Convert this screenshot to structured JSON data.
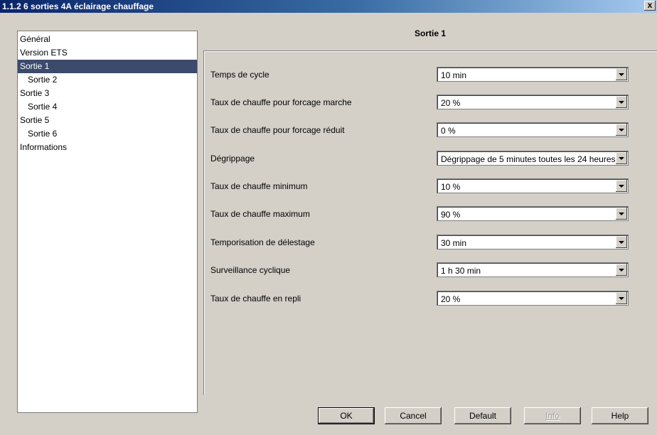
{
  "window": {
    "title": "1.1.2 6 sorties 4A éclairage chauffage",
    "close_glyph": "x"
  },
  "tree": {
    "items": [
      {
        "label": "Général",
        "level": 0,
        "selected": false
      },
      {
        "label": "Version ETS",
        "level": 0,
        "selected": false
      },
      {
        "label": "Sortie 1",
        "level": 0,
        "selected": true
      },
      {
        "label": "Sortie 2",
        "level": 1,
        "selected": false
      },
      {
        "label": "Sortie 3",
        "level": 0,
        "selected": false
      },
      {
        "label": "Sortie 4",
        "level": 1,
        "selected": false
      },
      {
        "label": "Sortie 5",
        "level": 0,
        "selected": false
      },
      {
        "label": "Sortie 6",
        "level": 1,
        "selected": false
      },
      {
        "label": "Informations",
        "level": 0,
        "selected": false
      }
    ]
  },
  "panel": {
    "title": "Sortie 1",
    "params": [
      {
        "label": "Temps de cycle",
        "value": "10 min"
      },
      {
        "label": "Taux de chauffe pour forcage marche",
        "value": "20 %"
      },
      {
        "label": "Taux de chauffe pour forcage réduit",
        "value": "0 %"
      },
      {
        "label": "Dégrippage",
        "value": "Dégrippage de 5 minutes toutes les 24 heures"
      },
      {
        "label": "Taux de chauffe minimum",
        "value": "10 %"
      },
      {
        "label": "Taux de chauffe maximum",
        "value": "90 %"
      },
      {
        "label": "Temporisation de délestage",
        "value": "30 min"
      },
      {
        "label": "Surveillance cyclique",
        "value": "1 h 30 min"
      },
      {
        "label": "Taux de chauffe en repli",
        "value": "20 %"
      }
    ]
  },
  "buttons": {
    "ok": "OK",
    "cancel": "Cancel",
    "default": "Default",
    "info": "Info",
    "help": "Help"
  },
  "icons": {
    "dropdown_arrow": "chevron-down-icon",
    "close": "close-icon"
  }
}
